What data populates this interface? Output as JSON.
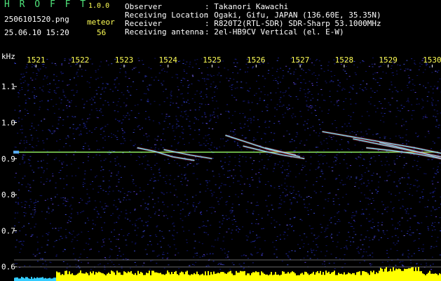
{
  "header": {
    "app_title": "H R O F F T",
    "app_version": "1.0.0",
    "file_name": "2506101520.png",
    "meteor_label": "meteor",
    "datetime": "25.06.10 15:20",
    "meteor_count": "56"
  },
  "info": [
    {
      "label": "Observer",
      "value": ": Takanori Kawachi"
    },
    {
      "label": "Receiving Location",
      "value": ": Ogaki, Gifu, JAPAN (136.60E, 35.35N)"
    },
    {
      "label": "Receiver",
      "value": ": R820T2(RTL-SDR) SDR-Sharp 53.1000MHz"
    },
    {
      "label": "Receiving antenna",
      "value": ": 2el-HB9CV Vertical (el. E-W)"
    }
  ],
  "axes": {
    "y_unit": "kHz",
    "x_ticks": [
      "1521",
      "1522",
      "1523",
      "1524",
      "1525",
      "1526",
      "1527",
      "1528",
      "1529",
      "1530"
    ],
    "y_ticks": [
      "1.1",
      "1.0",
      "0.9",
      "0.8",
      "0.7",
      "0.6"
    ]
  },
  "colors": {
    "background": "#000000",
    "noise": "#1a1f8c",
    "carrier": "#9aff66",
    "tick_label": "#ffff55",
    "histogram": "#ffff00",
    "histogram_start": "#33ccff"
  },
  "chart_data": {
    "type": "heatmap",
    "x_range": [
      1520.5,
      1530.2
    ],
    "y_range": [
      0.58,
      1.19
    ],
    "carrier_frequency_khz": 0.918,
    "meteor_traces": [
      {
        "x": [
          1523.3,
          1523.7,
          1524.1,
          1524.6
        ],
        "y": [
          0.93,
          0.92,
          0.905,
          0.895
        ]
      },
      {
        "x": [
          1523.9,
          1524.5,
          1525.0
        ],
        "y": [
          0.925,
          0.91,
          0.9
        ]
      },
      {
        "x": [
          1525.3,
          1525.8,
          1526.3,
          1526.9
        ],
        "y": [
          0.965,
          0.945,
          0.925,
          0.91
        ]
      },
      {
        "x": [
          1525.7,
          1526.2,
          1526.6,
          1527.1
        ],
        "y": [
          0.935,
          0.92,
          0.91,
          0.9
        ]
      },
      {
        "x": [
          1526.2,
          1526.6,
          1527.0
        ],
        "y": [
          0.93,
          0.918,
          0.905
        ]
      },
      {
        "x": [
          1527.5,
          1528.2,
          1528.9,
          1529.6,
          1530.2
        ],
        "y": [
          0.975,
          0.96,
          0.945,
          0.93,
          0.915
        ]
      },
      {
        "x": [
          1528.2,
          1528.8,
          1529.4,
          1530.2
        ],
        "y": [
          0.955,
          0.94,
          0.925,
          0.905
        ]
      },
      {
        "x": [
          1528.8,
          1529.3,
          1529.8,
          1530.2
        ],
        "y": [
          0.945,
          0.93,
          0.915,
          0.9
        ]
      },
      {
        "x": [
          1528.5,
          1529.1,
          1529.7,
          1530.2
        ],
        "y": [
          0.93,
          0.922,
          0.912,
          0.9
        ]
      }
    ]
  }
}
